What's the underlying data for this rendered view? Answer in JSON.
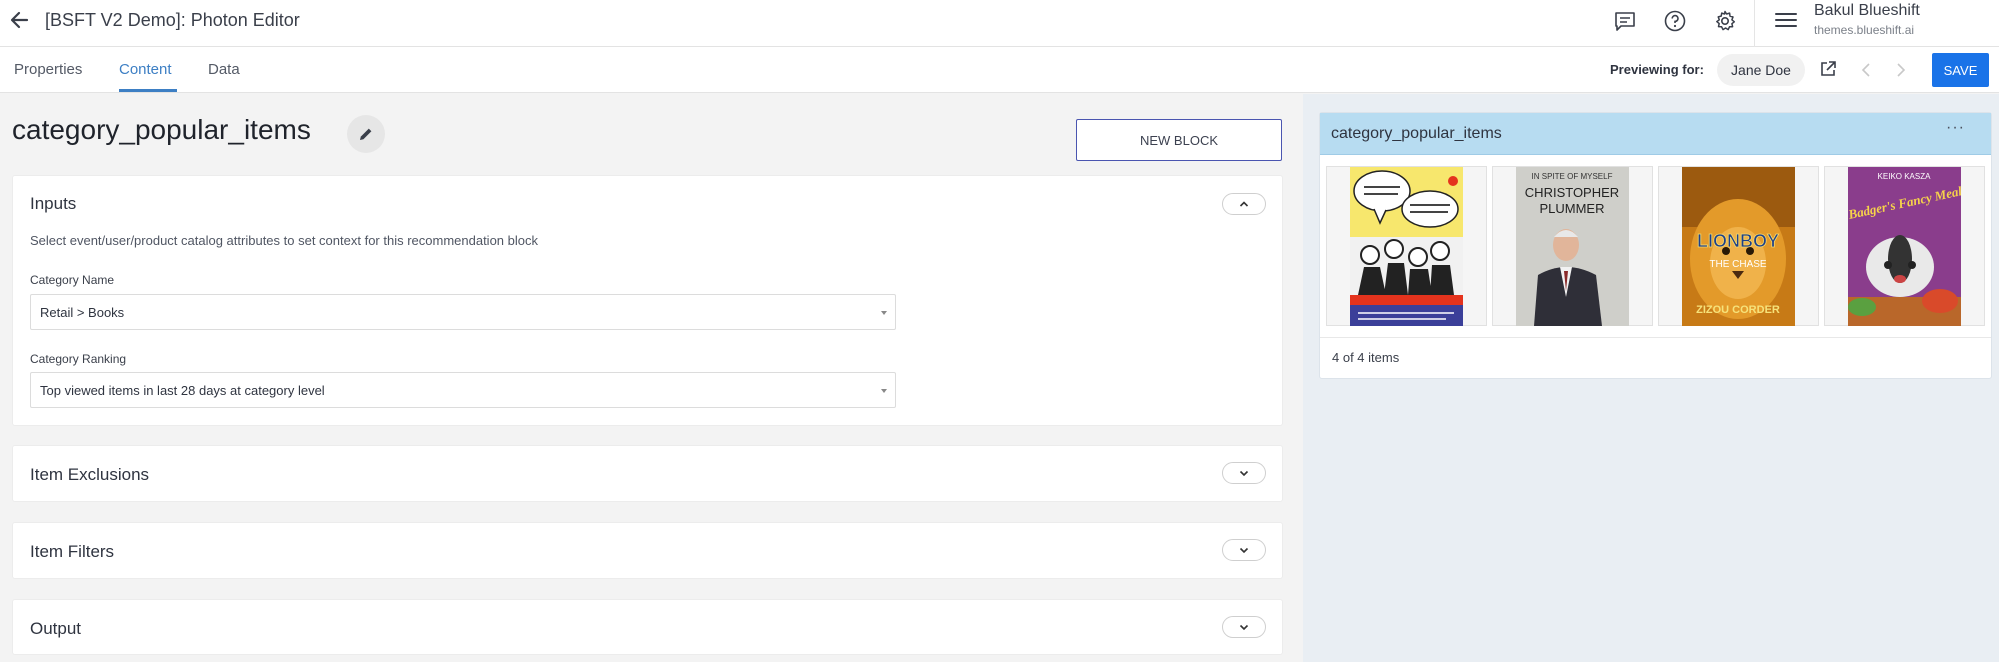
{
  "header": {
    "title": "[BSFT V2 Demo]: Photon Editor",
    "user_name": "Bakul Blueshift",
    "user_domain": "themes.blueshift.ai"
  },
  "tabs": [
    {
      "label": "Properties",
      "active": false
    },
    {
      "label": "Content",
      "active": true
    },
    {
      "label": "Data",
      "active": false
    }
  ],
  "preview": {
    "label": "Previewing for:",
    "user": "Jane Doe",
    "save_label": "SAVE"
  },
  "editor": {
    "block_title": "category_popular_items",
    "new_block_label": "NEW BLOCK",
    "inputs": {
      "title": "Inputs",
      "helper": "Select event/user/product catalog attributes to set context for this recommendation block",
      "category_name_label": "Category Name",
      "category_name_value": "Retail > Books",
      "category_ranking_label": "Category Ranking",
      "category_ranking_value": "Top viewed items in last 28 days at category level"
    },
    "sections": {
      "exclusions": "Item Exclusions",
      "filters": "Item Filters",
      "output": "Output"
    }
  },
  "preview_card": {
    "title": "category_popular_items",
    "more": "···",
    "count": "4 of 4 items",
    "books": [
      {
        "name": "book-cover-everything-you-wanted-to-know"
      },
      {
        "name": "book-cover-in-spite-of-myself",
        "top_text": "IN SPITE OF MYSELF",
        "author_first": "CHRISTOPHER",
        "author_last": "PLUMMER"
      },
      {
        "name": "book-cover-lionboy",
        "title_line1": "LIONBOY",
        "title_line2": "THE CHASE",
        "author": "ZIZOU CORDER"
      },
      {
        "name": "book-cover-badgers-fancy-meal",
        "author": "KEIKO KASZA",
        "title": "Badger's Fancy Meal"
      }
    ]
  },
  "colors": {
    "accent": "#3d7fc4",
    "save_button": "#1a73e8",
    "preview_header": "#b7dcf1",
    "preview_background": "#e9eef3"
  }
}
